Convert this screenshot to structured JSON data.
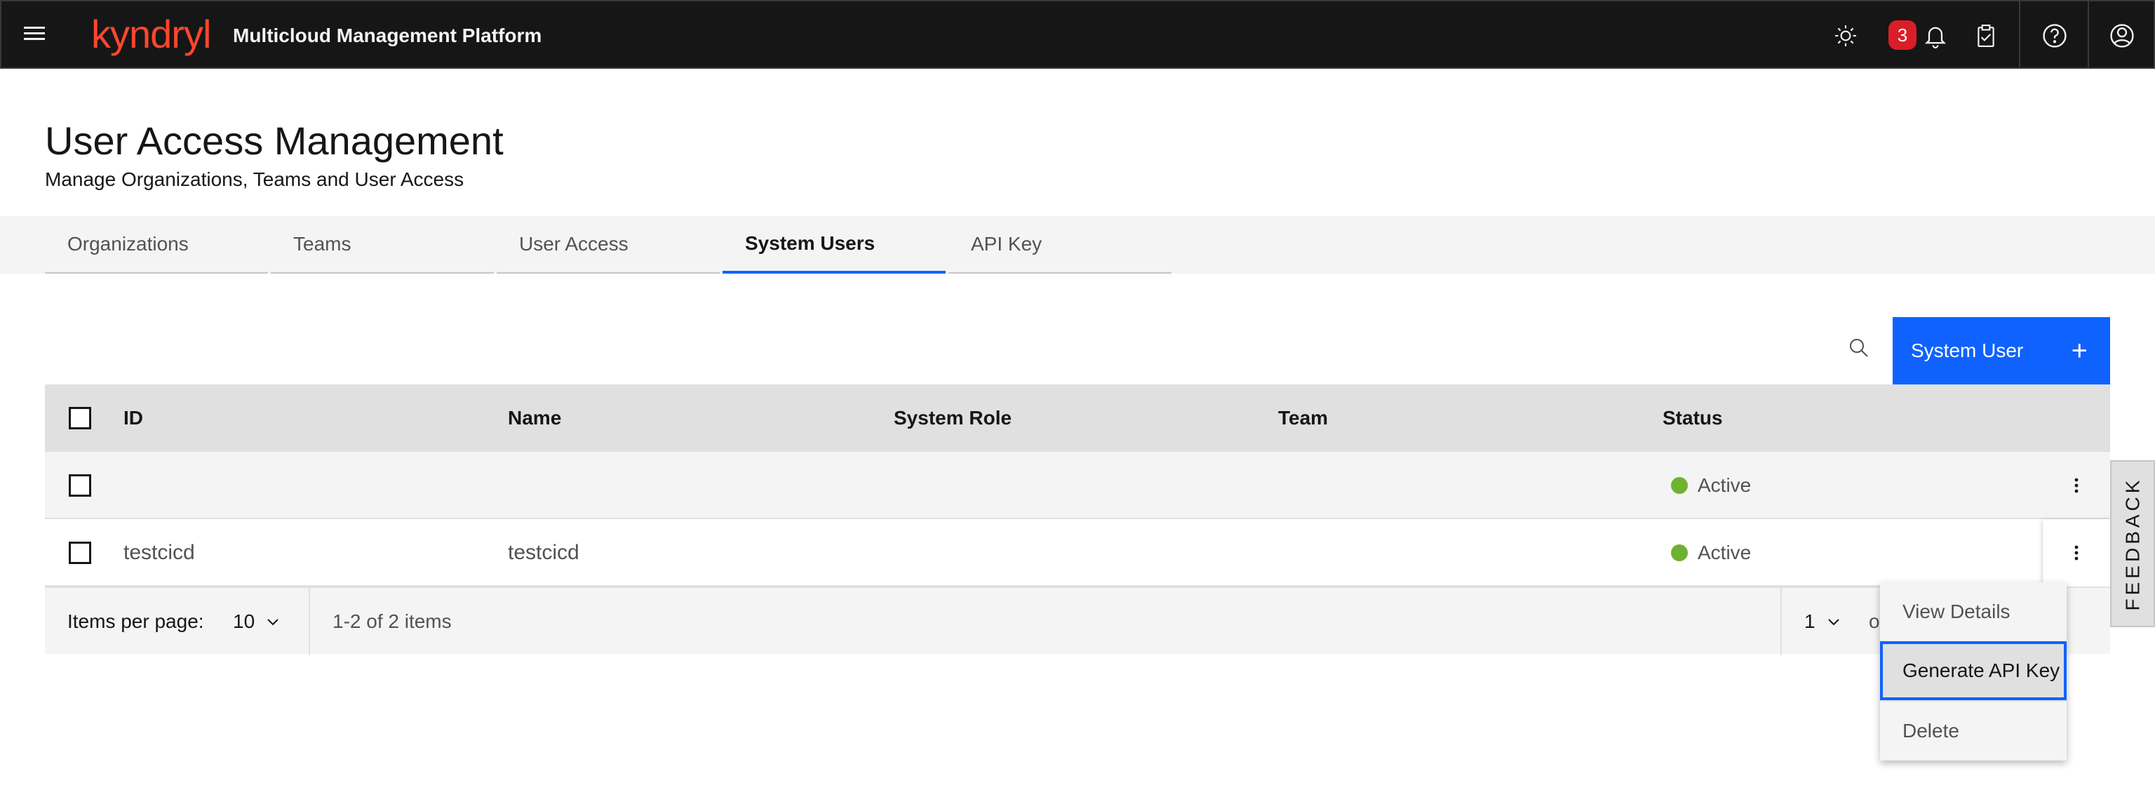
{
  "header": {
    "logo": "kyndryl",
    "app_title": "Multicloud Management Platform",
    "notification_count": "3"
  },
  "page": {
    "title": "User Access Management",
    "subtitle": "Manage Organizations, Teams and User Access"
  },
  "tabs": [
    {
      "label": "Organizations",
      "active": false
    },
    {
      "label": "Teams",
      "active": false
    },
    {
      "label": "User Access",
      "active": false
    },
    {
      "label": "System Users",
      "active": true
    },
    {
      "label": "API Key",
      "active": false
    }
  ],
  "toolbar": {
    "add_button_label": "System User",
    "add_button_icon": "+"
  },
  "table": {
    "columns": [
      "ID",
      "Name",
      "System Role",
      "Team",
      "Status"
    ],
    "rows": [
      {
        "id": "",
        "name": "",
        "system_role": "",
        "team": "",
        "status": "Active"
      },
      {
        "id": "testcicd",
        "name": "testcicd",
        "system_role": "",
        "team": "",
        "status": "Active"
      }
    ]
  },
  "pagination": {
    "items_per_page_label": "Items per page:",
    "items_per_page": "10",
    "range": "1-2 of 2 items",
    "page": "1",
    "of_text": "o"
  },
  "menu": {
    "items": [
      "View Details",
      "Generate API Key",
      "Delete"
    ]
  },
  "feedback": "FEEDBACK",
  "colors": {
    "header_bg": "#161616",
    "brand": "#ff462d",
    "primary": "#0f62fe",
    "status_active": "#6eb230",
    "badge": "#da1e28"
  }
}
